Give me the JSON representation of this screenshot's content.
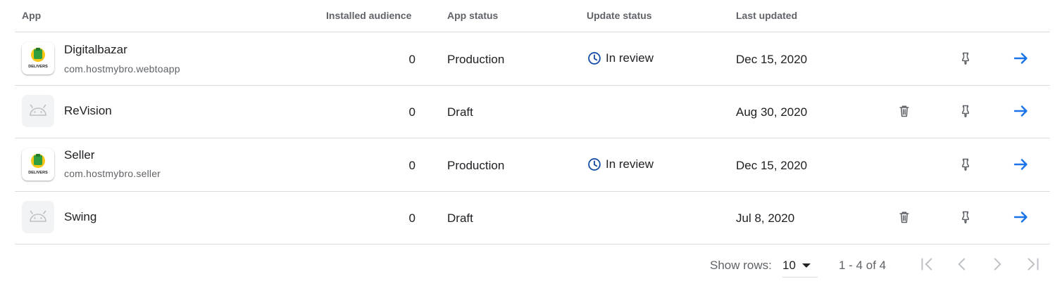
{
  "table": {
    "headers": {
      "app": "App",
      "installed_audience": "Installed audience",
      "app_status": "App status",
      "update_status": "Update status",
      "last_updated": "Last updated"
    },
    "rows": [
      {
        "name": "Digitalbazar",
        "package": "com.hostmybro.webtoapp",
        "audience": "0",
        "status": "Production",
        "update_status": "In review",
        "last_updated": "Dec 15, 2020",
        "icon": "delivers-logo",
        "can_delete": false
      },
      {
        "name": "ReVision",
        "package": "",
        "audience": "0",
        "status": "Draft",
        "update_status": "",
        "last_updated": "Aug 30, 2020",
        "icon": "android-icon",
        "can_delete": true
      },
      {
        "name": "Seller",
        "package": "com.hostmybro.seller",
        "audience": "0",
        "status": "Production",
        "update_status": "In review",
        "last_updated": "Dec 15, 2020",
        "icon": "delivers-logo",
        "can_delete": false
      },
      {
        "name": "Swing",
        "package": "",
        "audience": "0",
        "status": "Draft",
        "update_status": "",
        "last_updated": "Jul 8, 2020",
        "icon": "android-icon",
        "can_delete": true
      }
    ],
    "logo_text": "DELIVERS"
  },
  "pagination": {
    "show_rows_label": "Show rows:",
    "rows_per_page": "10",
    "range": "1 - 4 of 4"
  },
  "colors": {
    "accent_blue": "#1a73e8",
    "icon_gray": "#5f6368",
    "clock_blue": "#174ea6",
    "divider": "#dadce0"
  }
}
